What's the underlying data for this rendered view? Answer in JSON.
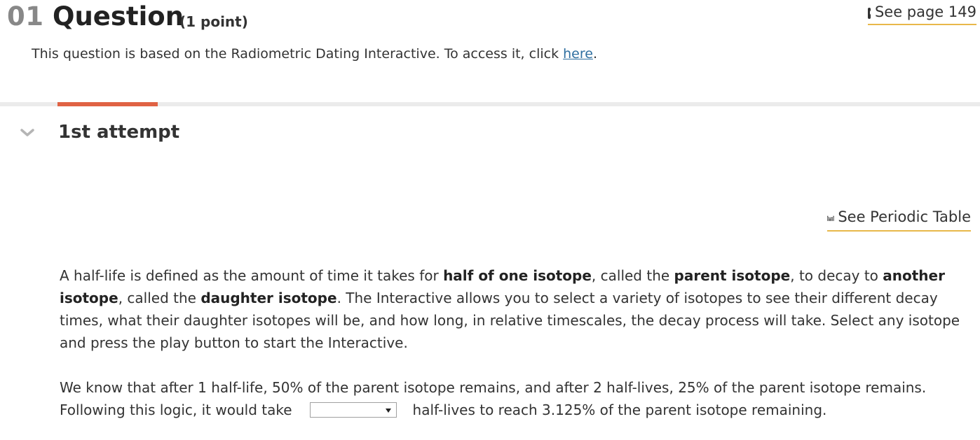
{
  "question": {
    "number": "01",
    "title": "Question",
    "points": "(1 point)",
    "see_page": "See page 149",
    "intro_before": "This question is based on the Radiometric Dating Interactive. To access it, click ",
    "intro_link": "here",
    "intro_after": "."
  },
  "attempt": {
    "label": "1st attempt",
    "periodic_table": "See Periodic Table"
  },
  "paragraph1": {
    "t1": "A half-life is defined as the amount of time it takes for ",
    "b1": "half of one isotope",
    "t2": ", called the ",
    "b2": "parent isotope",
    "t3": ", to decay to ",
    "b3": "another isotope",
    "t4": ", called the ",
    "b4": "daughter isotope",
    "t5": ". The Interactive allows you to select a variety of isotopes to see their different decay times, what their daughter isotopes will be, and how long, in relative timescales, the decay process will take. Select any isotope and press the play button to start the Interactive."
  },
  "paragraph2": {
    "before": "We know that after 1 half-life, 50% of the parent isotope remains, and after 2 half-lives, 25% of the parent isotope remains. Following this logic, it would take",
    "after": "half-lives to reach 3.125% of the parent isotope remaining.",
    "dropdown_value": ""
  },
  "colors": {
    "accent_tab": "#e06244",
    "link_underline": "#e8b84a",
    "link": "#2f6fa0"
  },
  "icons": [
    "book-icon",
    "chevron-down-icon",
    "periodic-table-icon",
    "dropdown-arrow-icon"
  ]
}
